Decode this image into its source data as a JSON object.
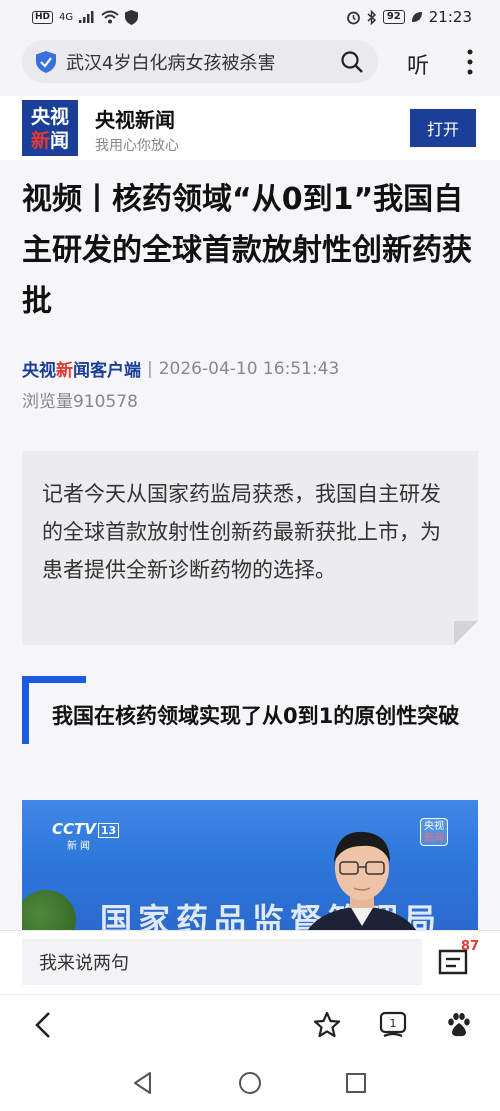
{
  "status_bar": {
    "hd": "HD",
    "network": "4G",
    "battery": "92",
    "time": "21:23"
  },
  "search": {
    "query": "武汉4岁白化病女孩被杀害",
    "listen_label": "听"
  },
  "app_banner": {
    "logo_line1": "央视",
    "logo_line2a": "新",
    "logo_line2b": "闻",
    "name": "央视新闻",
    "slogan": "我用心你放心",
    "open_label": "打开"
  },
  "article": {
    "headline": "视频丨核药领域“从0到1”我国自主研发的全球首款放射性创新药获批",
    "source_a": "央视",
    "source_b": "新",
    "source_c": "闻客户端",
    "separator": "|",
    "datetime": "2026-04-10 16:51:43",
    "views": "浏览量910578",
    "summary": "记者今天从国家药监局获悉，我国自主研发的全球首款放射性创新药最新获批上市，为患者提供全新诊断药物的选择。",
    "section_title": "我国在核药领域实现了从0到1的原创性突破"
  },
  "video": {
    "channel_logo": "CCTV",
    "channel_num": "13",
    "channel_sub": "新闻",
    "corner_logo_a": "央视",
    "corner_logo_b": "新闻",
    "background_text": "国家药品监督管理局"
  },
  "comment": {
    "placeholder": "我来说两句",
    "count": "87"
  },
  "browser_bar": {
    "items": [
      "back-icon",
      "star-icon",
      "tabs-icon",
      "baidu-paw-icon"
    ],
    "tabs_count": "1"
  },
  "system_nav": [
    "back-triangle",
    "home-circle",
    "recents-square"
  ]
}
